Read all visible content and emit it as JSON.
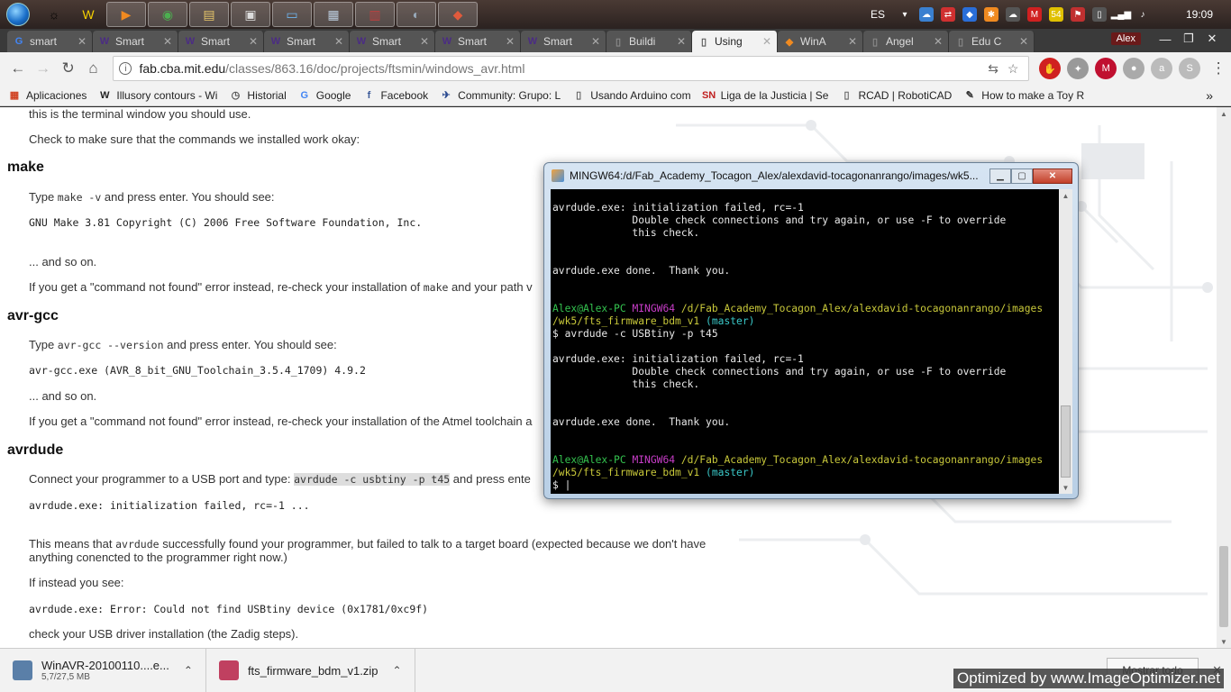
{
  "taskbar": {
    "apps": [
      {
        "name": "wacom-tablet-app-icon",
        "glyph": "☼",
        "active": false,
        "plain": true,
        "color": "#000"
      },
      {
        "name": "arduino-w-app-icon",
        "glyph": "W",
        "active": false,
        "plain": true,
        "color": "#f5d000"
      },
      {
        "name": "media-player-app-icon",
        "glyph": "▶",
        "active": true,
        "color": "#f08a20"
      },
      {
        "name": "chrome-app-icon",
        "glyph": "◉",
        "active": true,
        "color": "#4caf50"
      },
      {
        "name": "file-explorer-app-icon",
        "glyph": "▤",
        "active": true,
        "color": "#e7c66a"
      },
      {
        "name": "document-app-icon",
        "glyph": "▣",
        "active": true,
        "color": "#dcdcdc"
      },
      {
        "name": "remote-desktop-app-icon",
        "glyph": "▭",
        "active": true,
        "color": "#6fb6f0"
      },
      {
        "name": "notepad-app-icon",
        "glyph": "▦",
        "active": true,
        "color": "#bcd"
      },
      {
        "name": "winrar-app-icon",
        "glyph": "▥",
        "active": true,
        "color": "#c04040"
      },
      {
        "name": "eagle-app-icon",
        "glyph": "◐",
        "active": true,
        "color": "#9ab"
      },
      {
        "name": "git-app-icon",
        "glyph": "◆",
        "active": true,
        "color": "#e05a3c"
      }
    ],
    "language": "ES",
    "tray_icons": [
      {
        "name": "onedrive-tray-icon",
        "glyph": "☁",
        "bg": "#3a80d0"
      },
      {
        "name": "teamviewer-tray-icon",
        "glyph": "⇄",
        "bg": "#d03030"
      },
      {
        "name": "dropbox-tray-icon",
        "glyph": "◆",
        "bg": "#2a6ed8"
      },
      {
        "name": "avast-tray-icon",
        "glyph": "✱",
        "bg": "#f08a20"
      },
      {
        "name": "cloud-tray-icon",
        "glyph": "☁",
        "bg": "#555"
      },
      {
        "name": "mega-tray-icon",
        "glyph": "M",
        "bg": "#d02020"
      },
      {
        "name": "badge-tray-icon",
        "glyph": "54",
        "bg": "#e0c000"
      },
      {
        "name": "flag-tray-icon",
        "glyph": "⚑",
        "bg": "#c03030"
      },
      {
        "name": "usb-tray-icon",
        "glyph": "▯",
        "bg": "#555"
      },
      {
        "name": "signal-tray-icon",
        "glyph": "▂▄▆",
        "bg": "transparent"
      },
      {
        "name": "volume-tray-icon",
        "glyph": "♪",
        "bg": "transparent"
      }
    ],
    "clock": "19:09"
  },
  "tabs": [
    {
      "name": "tab-smart-google",
      "label": "smart",
      "fav": "G",
      "fav_color": "#4285f4",
      "active": false
    },
    {
      "name": "tab-smart-1",
      "label": "Smart",
      "fav": "W",
      "fav_color": "#4b2c84",
      "active": false
    },
    {
      "name": "tab-smart-2",
      "label": "Smart",
      "fav": "W",
      "fav_color": "#4b2c84",
      "active": false
    },
    {
      "name": "tab-smart-3",
      "label": "Smart",
      "fav": "W",
      "fav_color": "#4b2c84",
      "active": false
    },
    {
      "name": "tab-smart-4",
      "label": "Smart",
      "fav": "W",
      "fav_color": "#4b2c84",
      "active": false
    },
    {
      "name": "tab-smart-5",
      "label": "Smart",
      "fav": "W",
      "fav_color": "#4b2c84",
      "active": false
    },
    {
      "name": "tab-smart-6",
      "label": "Smart",
      "fav": "W",
      "fav_color": "#4b2c84",
      "active": false
    },
    {
      "name": "tab-building",
      "label": "Buildi",
      "fav": "▯",
      "fav_color": "#888",
      "active": false
    },
    {
      "name": "tab-using",
      "label": "Using",
      "fav": "▯",
      "fav_color": "#555",
      "active": true
    },
    {
      "name": "tab-winavr",
      "label": "WinA",
      "fav": "◆",
      "fav_color": "#f08a20",
      "active": false
    },
    {
      "name": "tab-angel",
      "label": "Angel",
      "fav": "▯",
      "fav_color": "#888",
      "active": false
    },
    {
      "name": "tab-edu",
      "label": "Edu C",
      "fav": "▯",
      "fav_color": "#888",
      "active": false
    }
  ],
  "profile": "Alex",
  "window_controls": {
    "minimize": "—",
    "maximize": "❐",
    "close": "✕"
  },
  "toolbar": {
    "url_host": "fab.cba.mit.edu",
    "url_path": "/classes/863.16/doc/projects/ftsmin/windows_avr.html",
    "translate_glyph": "⇆",
    "star_glyph": "☆",
    "extensions": [
      {
        "name": "adblock-extension-icon",
        "glyph": "✋",
        "bg": "#d02020"
      },
      {
        "name": "extension-2-icon",
        "glyph": "✦",
        "bg": "#999"
      },
      {
        "name": "mega-extension-icon",
        "glyph": "M",
        "bg": "#c01030"
      },
      {
        "name": "extension-4-icon",
        "glyph": "●",
        "bg": "#aaa"
      },
      {
        "name": "extension-5-icon",
        "glyph": "a",
        "bg": "#bbb"
      },
      {
        "name": "skype-extension-icon",
        "glyph": "S",
        "bg": "#bbb"
      }
    ],
    "menu_glyph": "⋮"
  },
  "bookmarks": [
    {
      "name": "bookmark-aplicaciones",
      "label": "Aplicaciones",
      "icon": "▦",
      "color": "#d04020"
    },
    {
      "name": "bookmark-illusory-contours",
      "label": "Illusory contours - Wi",
      "icon": "W",
      "color": "#222"
    },
    {
      "name": "bookmark-historial",
      "label": "Historial",
      "icon": "◷",
      "color": "#555"
    },
    {
      "name": "bookmark-google",
      "label": "Google",
      "icon": "G",
      "color": "#4285f4"
    },
    {
      "name": "bookmark-facebook",
      "label": "Facebook",
      "icon": "f",
      "color": "#3b5998"
    },
    {
      "name": "bookmark-community-grupo",
      "label": "Community: Grupo: L",
      "icon": "✈",
      "color": "#2a4a90"
    },
    {
      "name": "bookmark-usando-arduino",
      "label": "Usando Arduino com",
      "icon": "▯",
      "color": "#666"
    },
    {
      "name": "bookmark-liga-justicia",
      "label": "Liga de la Justicia | Se",
      "icon": "SN",
      "color": "#c02020"
    },
    {
      "name": "bookmark-rcad",
      "label": "RCAD | RobotiCAD",
      "icon": "▯",
      "color": "#666"
    },
    {
      "name": "bookmark-toy-robot",
      "label": "How to make a Toy R",
      "icon": "✎",
      "color": "#333"
    }
  ],
  "bookmarks_more": "»",
  "doc": {
    "terminal_note": "this is the terminal window you should use.",
    "check_line": "Check to make sure that the commands we installed work okay:",
    "make_heading": "make",
    "make_type_pre": "Type ",
    "make_cmd": "make -v",
    "make_type_post": " and press enter. You should see:",
    "make_output": "GNU Make 3.81\nCopyright (C) 2006 Free Software Foundation, Inc.",
    "and_so_on_1": "... and so on.",
    "make_error_pre": "If you get a \"command not found\" error instead, re-check your installation of ",
    "make_error_code": "make",
    "make_error_post": " and your path v",
    "avrgcc_heading": "avr-gcc",
    "avrgcc_type_pre": "Type ",
    "avrgcc_cmd": "avr-gcc --version",
    "avrgcc_type_post": " and press enter. You should see:",
    "avrgcc_output": "avr-gcc.exe (AVR_8_bit_GNU_Toolchain_3.5.4_1709) 4.9.2",
    "and_so_on_2": "... and so on.",
    "avrgcc_error": "If you get a \"command not found\" error instead, re-check your installation of the Atmel toolchain a",
    "avrdude_heading": "avrdude",
    "avrdude_connect_pre": "Connect your programmer to a USB port and type: ",
    "avrdude_cmd": "avrdude -c usbtiny -p t45",
    "avrdude_connect_post": " and press ente",
    "avrdude_output": "avrdude.exe: initialization failed, rc=-1\n...",
    "means_line_1": "This means that ",
    "means_code": "avrdude",
    "means_line_1_post": " successfully found your programmer, but failed to talk to a target board (expected because we don't have",
    "means_line_2": "anything conencted to the programmer right now.)",
    "instead_line": "If instead you see:",
    "error_output": "avrdude.exe: Error: Could not find USBtiny device (0x1781/0xc9f)",
    "zadig_line": "check your USB driver installation (the Zadig steps)."
  },
  "terminal": {
    "title": "MINGW64:/d/Fab_Academy_Tocagon_Alex/alexdavid-tocagonanrango/images/wk5...",
    "fail_1": "avrdude.exe: initialization failed, rc=-1",
    "fail_2": "             Double check connections and try again, or use -F to override",
    "fail_3": "             this check.",
    "done": "avrdude.exe done.  Thank you.",
    "prompt_user": "Alex@Alex-PC",
    "prompt_env": "MINGW64",
    "prompt_path_1": "/d/Fab_Academy_Tocagon_Alex/alexdavid-tocagonanrango/images",
    "prompt_path_2": "/wk5/fts_firmware_bdm_v1",
    "prompt_branch": "(master)",
    "command": "$ avrdude -c USBtiny -p t45",
    "cursor_prompt": "$ |"
  },
  "downloads": [
    {
      "name": "download-winavr",
      "label": "WinAVR-20100110....e...",
      "size": "5,7/27,5 MB",
      "icon_color": "#5a7fa8"
    },
    {
      "name": "download-fts-firmware",
      "label": "fts_firmware_bdm_v1.zip",
      "size": "",
      "icon_color": "#c04060"
    }
  ],
  "show_all": "Mostrar todo",
  "watermark": "Optimized by www.ImageOptimizer.net"
}
